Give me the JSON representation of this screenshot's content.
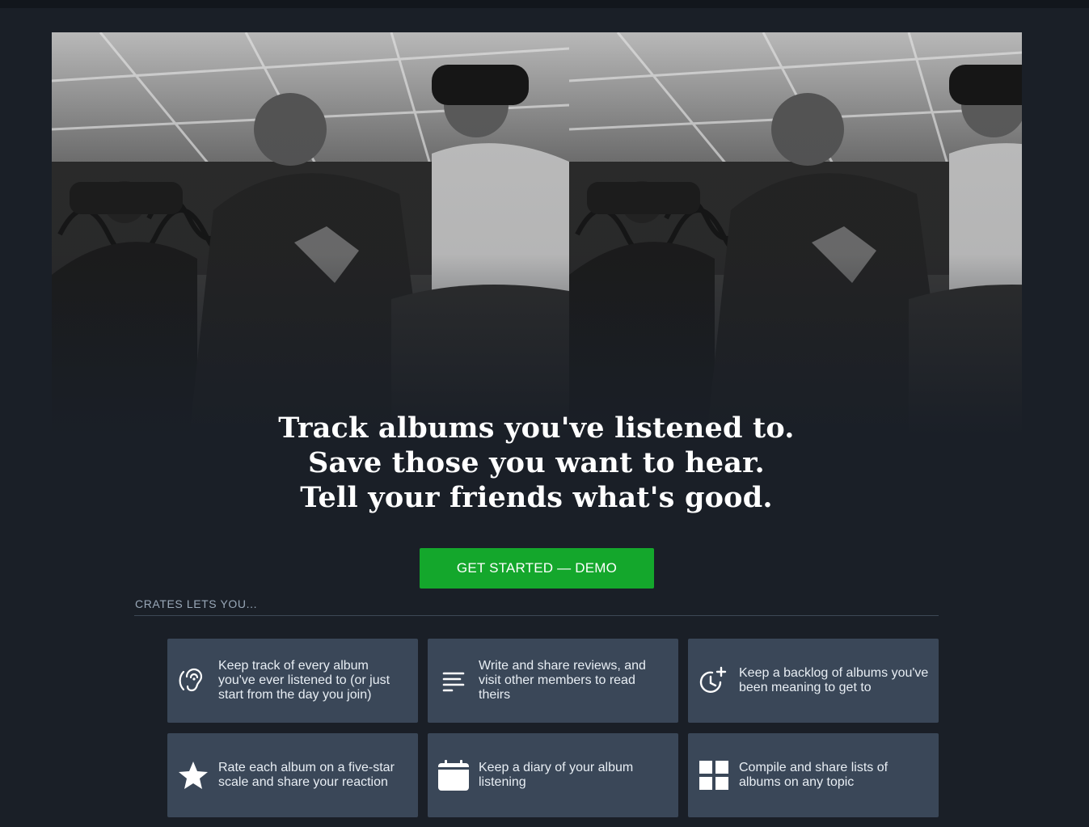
{
  "hero": {
    "headline_lines": [
      "Track albums you've listened to.",
      "Save those you want to hear.",
      "Tell your friends what's good."
    ]
  },
  "cta": {
    "label": "GET STARTED — DEMO"
  },
  "section": {
    "label": "CRATES LETS YOU..."
  },
  "features": [
    {
      "icon": "ear-icon",
      "text": "Keep track of every album you've ever listened to (or just start from the day you join)"
    },
    {
      "icon": "lines-icon",
      "text": "Write and share reviews, and visit other members to read theirs"
    },
    {
      "icon": "clock-plus-icon",
      "text": "Keep a backlog of albums you've been meaning to get to"
    },
    {
      "icon": "star-icon",
      "text": "Rate each album on a five-star scale and share your reaction"
    },
    {
      "icon": "calendar-icon",
      "text": "Keep a diary of your album listening"
    },
    {
      "icon": "grid-icon",
      "text": "Compile and share lists of albums on any topic"
    }
  ],
  "colors": {
    "background": "#1a1f27",
    "card": "#3a4758",
    "cta": "#14a72c",
    "label": "#99a8b8"
  }
}
